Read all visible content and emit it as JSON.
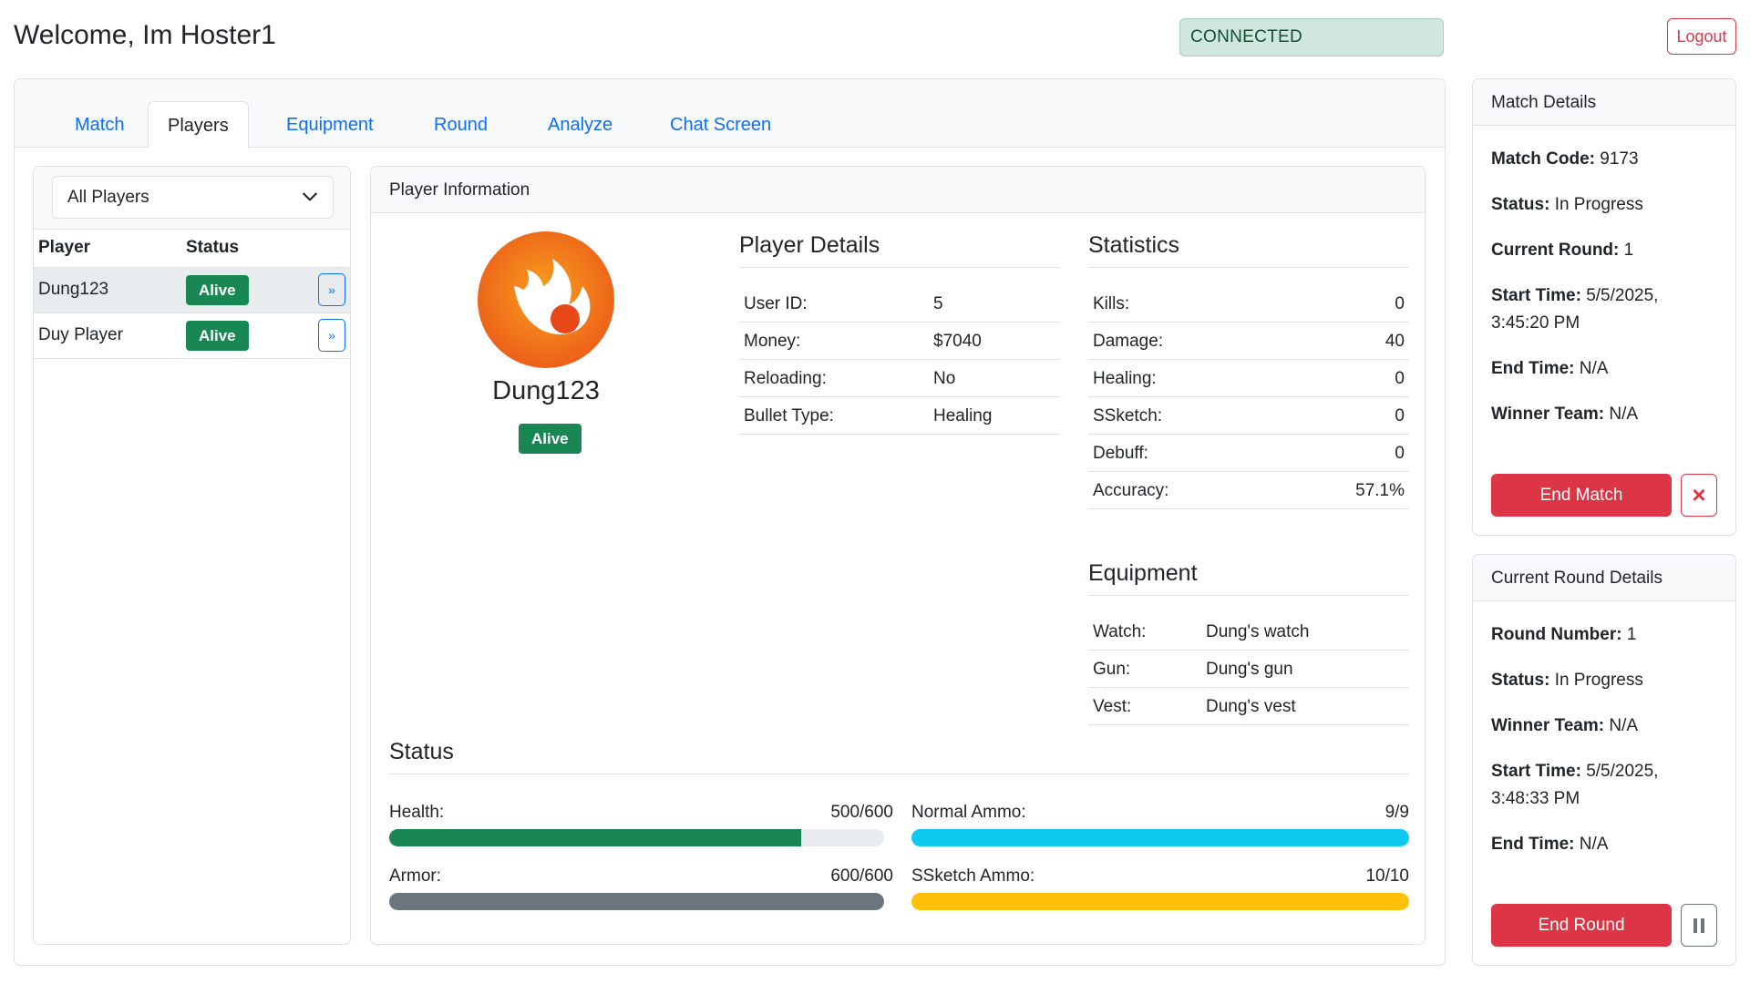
{
  "header": {
    "welcome": "Welcome, Im Hoster1",
    "connection_status": "CONNECTED",
    "logout_label": "Logout"
  },
  "tabs": [
    {
      "label": "Match",
      "active": false
    },
    {
      "label": "Players",
      "active": true
    },
    {
      "label": "Equipment",
      "active": false
    },
    {
      "label": "Round",
      "active": false
    },
    {
      "label": "Analyze",
      "active": false
    },
    {
      "label": "Chat Screen",
      "active": false
    }
  ],
  "players_panel": {
    "filter_value": "All Players",
    "columns": [
      "Player",
      "Status"
    ],
    "rows": [
      {
        "name": "Dung123",
        "status": "Alive",
        "selected": true
      },
      {
        "name": "Duy Player",
        "status": "Alive",
        "selected": false
      }
    ],
    "detail_button": "»"
  },
  "player_info": {
    "panel_title": "Player Information",
    "name": "Dung123",
    "status": "Alive",
    "details_title": "Player Details",
    "details": [
      {
        "label": "User ID:",
        "value": "5"
      },
      {
        "label": "Money:",
        "value": "$7040"
      },
      {
        "label": "Reloading:",
        "value": "No"
      },
      {
        "label": "Bullet Type:",
        "value": "Healing"
      }
    ],
    "statistics_title": "Statistics",
    "statistics": [
      {
        "label": "Kills:",
        "value": "0"
      },
      {
        "label": "Damage:",
        "value": "40"
      },
      {
        "label": "Healing:",
        "value": "0"
      },
      {
        "label": "SSketch:",
        "value": "0"
      },
      {
        "label": "Debuff:",
        "value": "0"
      },
      {
        "label": "Accuracy:",
        "value": "57.1%"
      }
    ],
    "equipment_title": "Equipment",
    "equipment": [
      {
        "label": "Watch:",
        "value": "Dung's watch"
      },
      {
        "label": "Gun:",
        "value": "Dung's gun"
      },
      {
        "label": "Vest:",
        "value": "Dung's vest"
      }
    ],
    "status_title": "Status",
    "bars": [
      {
        "label": "Health:",
        "value": "500/600",
        "fraction": 0.8333,
        "color": "#198754"
      },
      {
        "label": "Normal Ammo:",
        "value": "9/9",
        "fraction": 1.0,
        "color": "#0dcaf0"
      },
      {
        "label": "Armor:",
        "value": "600/600",
        "fraction": 1.0,
        "color": "#6c757d"
      },
      {
        "label": "SSketch Ammo:",
        "value": "10/10",
        "fraction": 1.0,
        "color": "#ffc107"
      }
    ]
  },
  "match_details": {
    "title": "Match Details",
    "match_code_label": "Match Code:",
    "match_code": "9173",
    "status_label": "Status:",
    "status": "In Progress",
    "current_round_label": "Current Round:",
    "current_round": "1",
    "start_time_label": "Start Time:",
    "start_time": "5/5/2025,",
    "start_time_2": "3:45:20 PM",
    "end_time_label": "End Time:",
    "end_time": "N/A",
    "winner_team_label": "Winner Team:",
    "winner_team": "N/A",
    "end_button": "End Match",
    "cancel_icon": "×"
  },
  "round_details": {
    "title": "Current Round Details",
    "round_number_label": "Round Number:",
    "round_number": "1",
    "status_label": "Status:",
    "status": "In Progress",
    "winner_team_label": "Winner Team:",
    "winner_team": "N/A",
    "start_time_label": "Start Time:",
    "start_time": "5/5/2025,",
    "start_time_2": "3:48:33 PM",
    "end_time_label": "End Time:",
    "end_time": "N/A",
    "end_button": "End Round"
  },
  "colors": {
    "primary": "#0d6efd",
    "success": "#198754",
    "danger": "#dc3545",
    "avatar_orange": "#f0661b"
  }
}
